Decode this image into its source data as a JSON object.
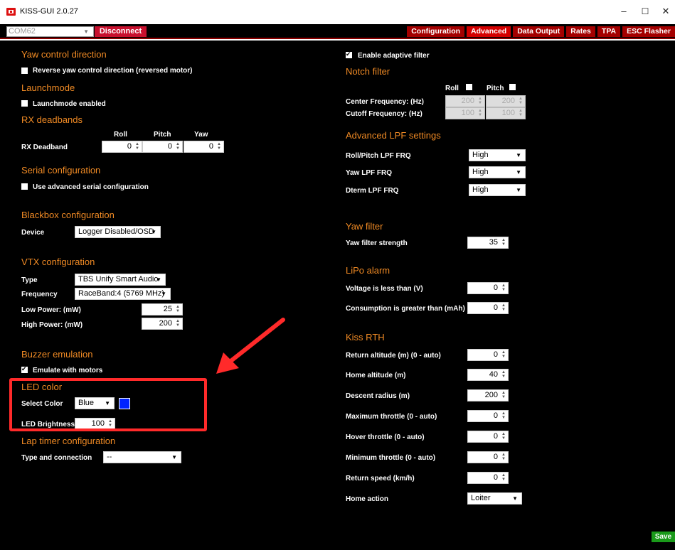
{
  "window": {
    "title": "KISS-GUI 2.0.27",
    "minimize": "–",
    "maximize": "☐",
    "close": "✕"
  },
  "toolbar": {
    "port": "COM62",
    "disconnect": "Disconnect",
    "tabs": [
      "Configuration",
      "Advanced",
      "Data Output",
      "Rates",
      "TPA",
      "ESC Flasher"
    ],
    "active_tab": "Advanced"
  },
  "left": {
    "yaw_title": "Yaw control direction",
    "yaw_reverse": "Reverse yaw control direction (reversed motor)",
    "launch_title": "Launchmode",
    "launch_enabled": "Launchmode enabled",
    "rx_title": "RX deadbands",
    "rx_head_roll": "Roll",
    "rx_head_pitch": "Pitch",
    "rx_head_yaw": "Yaw",
    "rx_label": "RX Deadband",
    "rx_roll": "0",
    "rx_pitch": "0",
    "rx_yaw": "0",
    "serial_title": "Serial configuration",
    "serial_adv": "Use advanced serial configuration",
    "bb_title": "Blackbox configuration",
    "bb_device_label": "Device",
    "bb_device": "Logger Disabled/OSD",
    "vtx_title": "VTX configuration",
    "vtx_type_label": "Type",
    "vtx_type": "TBS Unify Smart Audio",
    "vtx_freq_label": "Frequency",
    "vtx_freq": "RaceBand:4 (5769 MHz)",
    "vtx_low_label": "Low Power: (mW)",
    "vtx_low": "25",
    "vtx_high_label": "High Power: (mW)",
    "vtx_high": "200",
    "buzzer_title": "Buzzer emulation",
    "buzzer_motors": "Emulate with motors",
    "led_title": "LED color",
    "led_select_label": "Select Color",
    "led_color": "Blue",
    "led_swatch": "#0022ff",
    "led_bright_label": "LED Brightness %",
    "led_bright": "100",
    "lap_title": "Lap timer configuration",
    "lap_type_label": "Type and connection",
    "lap_type": "--"
  },
  "right": {
    "adaptive": "Enable adaptive filter",
    "notch_title": "Notch filter",
    "notch_roll": "Roll",
    "notch_pitch": "Pitch",
    "center_label": "Center Frequency: (Hz)",
    "center_roll": "200",
    "center_pitch": "200",
    "cutoff_label": "Cutoff Frequency: (Hz)",
    "cutoff_roll": "100",
    "cutoff_pitch": "100",
    "lpf_title": "Advanced LPF settings",
    "rp_lpf_label": "Roll/Pitch LPF FRQ",
    "rp_lpf": "High",
    "yaw_lpf_label": "Yaw LPF FRQ",
    "yaw_lpf": "High",
    "dterm_lpf_label": "Dterm LPF FRQ",
    "dterm_lpf": "High",
    "yawf_title": "Yaw filter",
    "yawf_label": "Yaw filter strength",
    "yawf": "35",
    "lipo_title": "LiPo alarm",
    "volt_label": "Voltage is less than (V)",
    "volt": "0",
    "cons_label": "Consumption is greater than (mAh)",
    "cons": "0",
    "rth_title": "Kiss RTH",
    "ret_alt_label": "Return altitude (m) (0 - auto)",
    "ret_alt": "0",
    "home_alt_label": "Home altitude (m)",
    "home_alt": "40",
    "descent_label": "Descent radius (m)",
    "descent": "200",
    "max_thr_label": "Maximum throttle (0 - auto)",
    "max_thr": "0",
    "hover_label": "Hover throttle (0 - auto)",
    "hover": "0",
    "min_thr_label": "Minimum throttle (0 - auto)",
    "min_thr": "0",
    "ret_speed_label": "Return speed (km/h)",
    "ret_speed": "0",
    "home_action_label": "Home action",
    "home_action": "Loiter"
  },
  "save": "Save",
  "annotation": {
    "arrow_color": "#ff2a2a"
  }
}
